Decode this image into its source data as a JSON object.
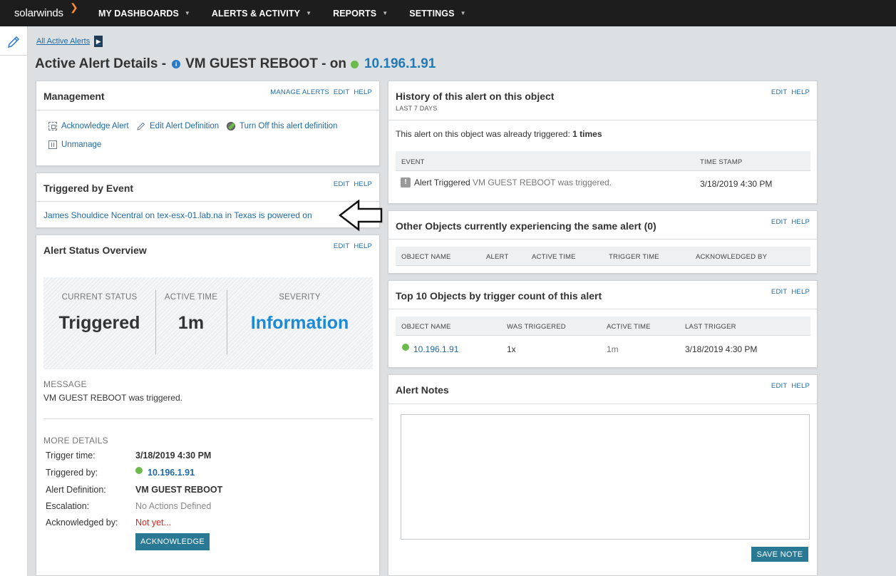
{
  "brand": {
    "name": "solarwinds"
  },
  "nav": [
    {
      "label": "MY DASHBOARDS"
    },
    {
      "label": "ALERTS & ACTIVITY"
    },
    {
      "label": "REPORTS"
    },
    {
      "label": "SETTINGS"
    }
  ],
  "breadcrumb": {
    "label": "All Active Alerts"
  },
  "page": {
    "title_prefix": "Active Alert Details -",
    "alert_name": "VM GUEST REBOOT - on",
    "object_ip": "10.196.1.91"
  },
  "management": {
    "title": "Management",
    "links": {
      "manage": "MANAGE ALERTS",
      "edit": "EDIT",
      "help": "HELP"
    },
    "actions": {
      "acknowledge": "Acknowledge Alert",
      "edit_def": "Edit Alert Definition",
      "turn_off": "Turn Off this alert definition",
      "unmanage": "Unmanage"
    }
  },
  "triggered_event": {
    "title": "Triggered by Event",
    "links": {
      "edit": "EDIT",
      "help": "HELP"
    },
    "message": "James Shouldice Ncentral on tex-esx-01.lab.na in Texas is powered on"
  },
  "status_overview": {
    "title": "Alert Status Overview",
    "links": {
      "edit": "EDIT",
      "help": "HELP"
    },
    "current_status_label": "CURRENT STATUS",
    "current_status": "Triggered",
    "active_time_label": "ACTIVE TIME",
    "active_time": "1m",
    "severity_label": "SEVERITY",
    "severity": "Information",
    "severity_color": "#1a8ad8",
    "message_label": "MESSAGE",
    "message": "VM GUEST REBOOT was triggered.",
    "more_details_label": "MORE DETAILS",
    "details": {
      "trigger_time_label": "Trigger time:",
      "trigger_time": "3/18/2019 4:30 PM",
      "triggered_by_label": "Triggered by:",
      "triggered_by": "10.196.1.91",
      "alert_def_label": "Alert Definition:",
      "alert_def": "VM GUEST REBOOT",
      "escalation_label": "Escalation:",
      "escalation": "No Actions Defined",
      "acknowledged_label": "Acknowledged by:",
      "acknowledged": "Not yet..."
    },
    "acknowledge_button": "ACKNOWLEDGE"
  },
  "history": {
    "title": "History of this alert on this object",
    "subtitle": "LAST 7 DAYS",
    "links": {
      "edit": "EDIT",
      "help": "HELP"
    },
    "summary_prefix": "This alert on this object was already triggered:",
    "summary_count": "1 times",
    "columns": {
      "event": "EVENT",
      "timestamp": "TIME STAMP"
    },
    "rows": [
      {
        "event_type": "Alert Triggered",
        "event_desc": "VM GUEST REBOOT was triggered.",
        "timestamp": "3/18/2019 4:30 PM"
      }
    ]
  },
  "other_objects": {
    "title": "Other Objects currently experiencing the same alert (0)",
    "links": {
      "edit": "EDIT",
      "help": "HELP"
    },
    "columns": {
      "object_name": "OBJECT NAME",
      "alert": "ALERT",
      "active_time": "ACTIVE TIME",
      "trigger_time": "TRIGGER TIME",
      "acknowledged_by": "ACKNOWLEDGED BY"
    }
  },
  "top10": {
    "title": "Top 10 Objects by trigger count of this alert",
    "links": {
      "edit": "EDIT",
      "help": "HELP"
    },
    "columns": {
      "object_name": "OBJECT NAME",
      "was_triggered": "WAS TRIGGERED",
      "active_time": "ACTIVE TIME",
      "last_trigger": "LAST TRIGGER"
    },
    "rows": [
      {
        "object_name": "10.196.1.91",
        "was_triggered": "1x",
        "active_time": "1m",
        "last_trigger": "3/18/2019 4:30 PM"
      }
    ]
  },
  "notes": {
    "title": "Alert Notes",
    "links": {
      "edit": "EDIT",
      "help": "HELP"
    },
    "value": "",
    "save_button": "SAVE NOTE"
  },
  "colors": {
    "topbar": "#1d1d1d",
    "accent_orange": "#f68d2e",
    "link_blue": "#1f6aa3",
    "status_green": "#6cba4c",
    "button_teal": "#297994",
    "warning_red": "#d9261c"
  }
}
